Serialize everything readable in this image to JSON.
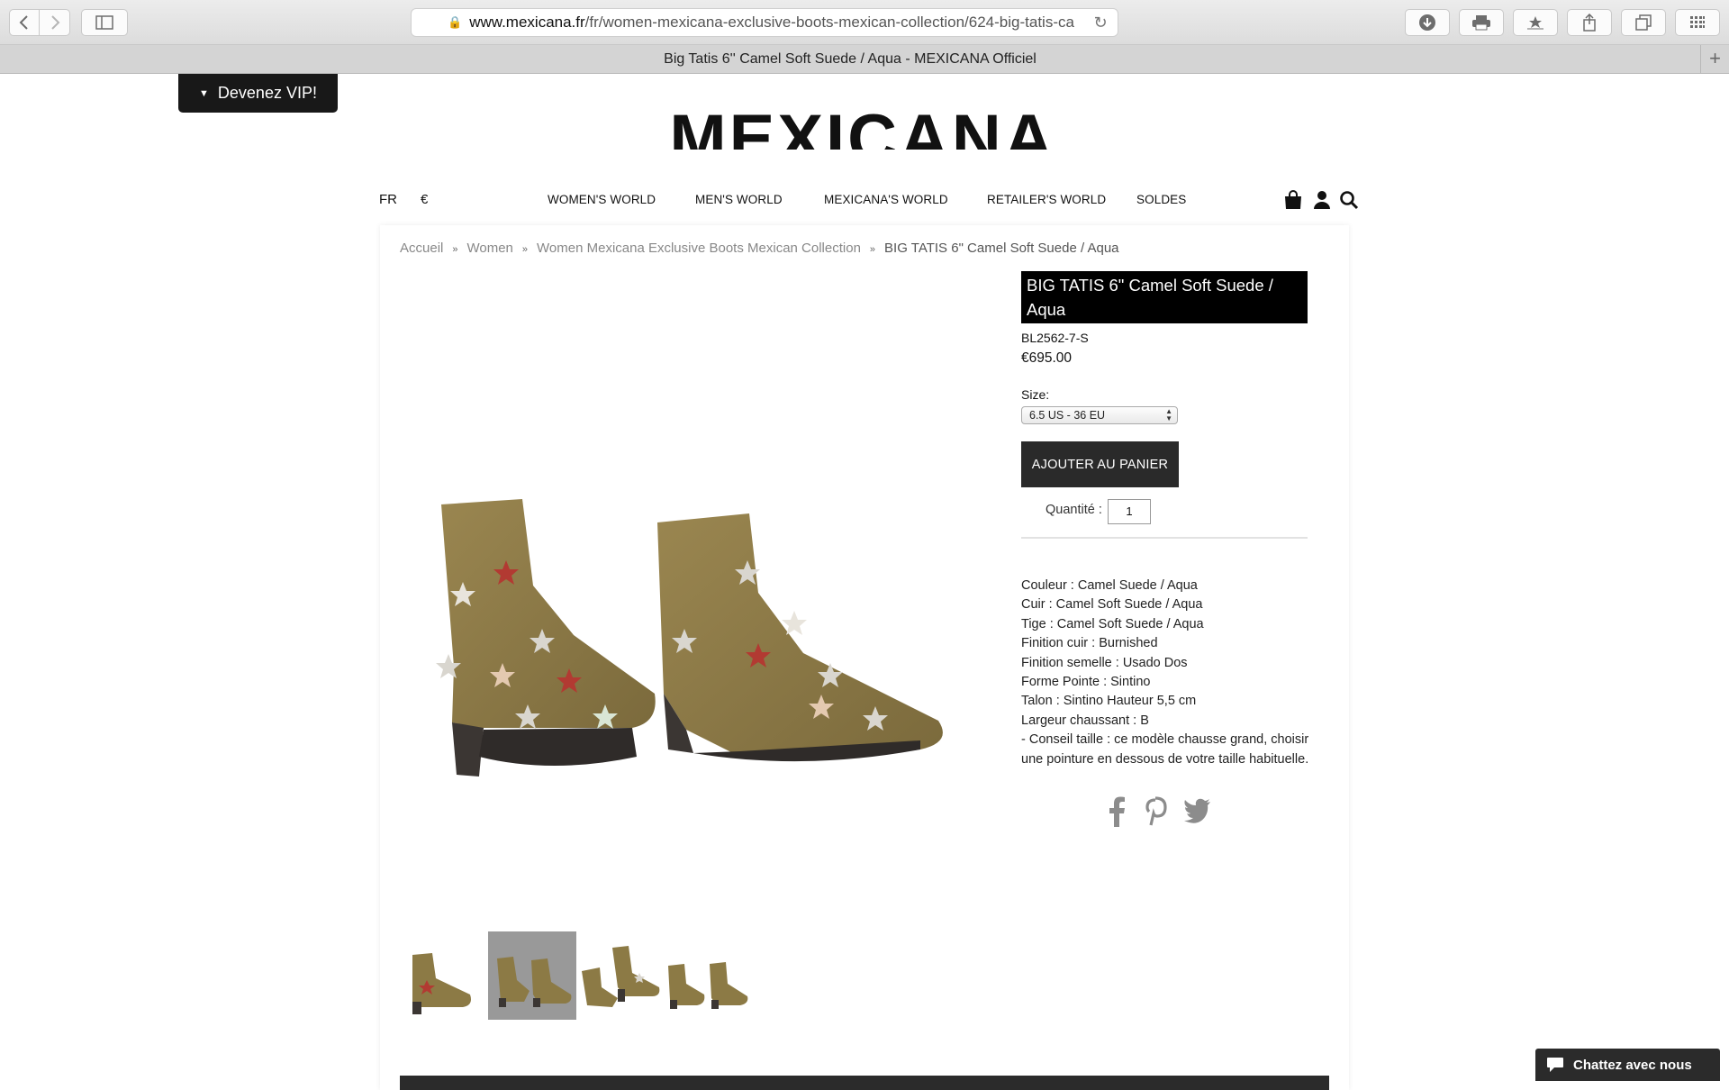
{
  "browser": {
    "url_host": "www.mexicana.fr",
    "url_path": "/fr/women-mexicana-exclusive-boots-mexican-collection/624-big-tatis-ca",
    "tab_title": "Big Tatis 6'' Camel Soft Suede / Aqua - MEXICANA Officiel"
  },
  "vip": {
    "label": "Devenez VIP!"
  },
  "logo": {
    "text": "MEXICANA"
  },
  "topnav": {
    "language": "FR",
    "currency": "€",
    "items": [
      "WOMEN'S WORLD",
      "MEN'S WORLD",
      "MEXICANA'S WORLD",
      "RETAILER'S WORLD",
      "SOLDES"
    ]
  },
  "breadcrumb": {
    "items": [
      "Accueil",
      "Women",
      "Women Mexicana Exclusive Boots Mexican Collection"
    ],
    "separator": "»",
    "current": "BIG TATIS 6\" Camel Soft Suede / Aqua"
  },
  "product": {
    "title": "BIG TATIS 6\" Camel Soft Suede / Aqua",
    "sku": "BL2562-7-S",
    "price": "€695.00",
    "size_label": "Size:",
    "size_value": "6.5 US - 36 EU",
    "add_to_cart": "AJOUTER AU PANIER",
    "quantity_label": "Quantité :",
    "quantity_value": "1",
    "attributes": [
      "Couleur : Camel Suede / Aqua",
      "Cuir : Camel Soft Suede / Aqua",
      "Tige : Camel Soft Suede / Aqua",
      "Finition cuir : Burnished",
      "Finition semelle : Usado Dos",
      "Forme Pointe : Sintino",
      "Talon : Sintino Hauteur 5,5 cm",
      "Largeur chaussant : B",
      "- Conseil taille : ce modèle chausse grand, choisir une pointure en dessous de votre taille habituelle."
    ]
  },
  "chat": {
    "label": "Chattez avec nous"
  },
  "colors": {
    "boot_suede": "#8c7a45",
    "boot_sole": "#3b3633",
    "star_red": "#b23a32",
    "dark": "#181818"
  }
}
